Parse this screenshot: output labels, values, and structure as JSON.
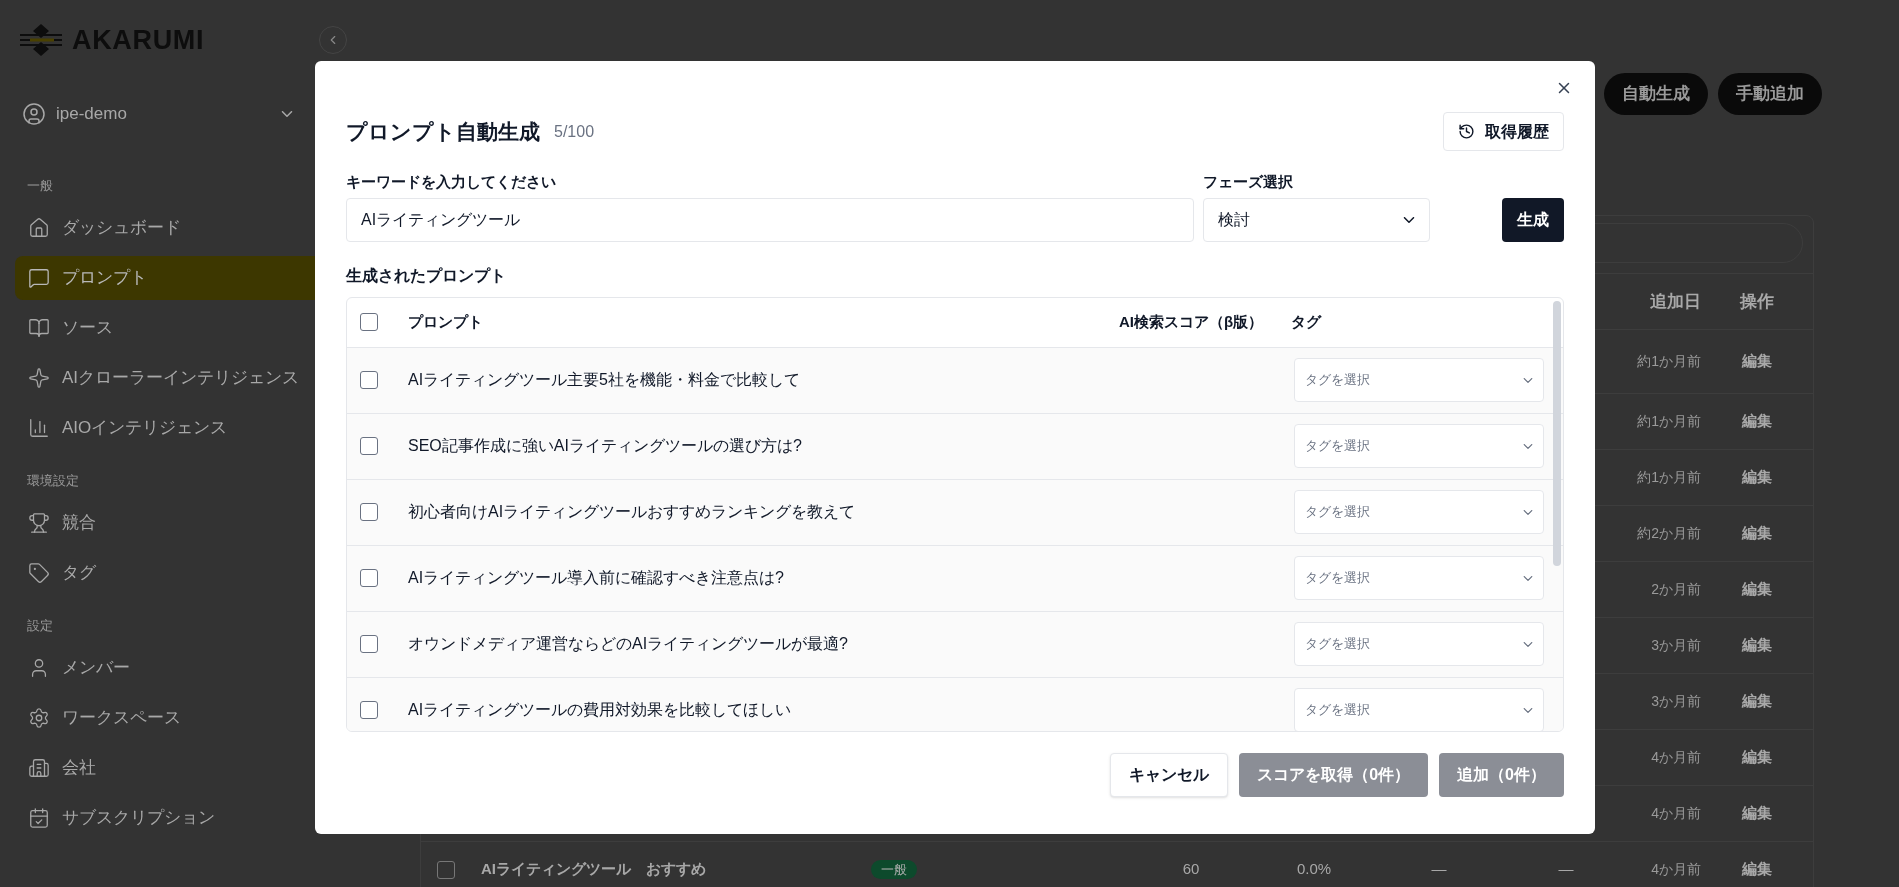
{
  "sidebar": {
    "brand": "AKARUMI",
    "account": "ipe-demo",
    "sections": [
      {
        "heading": "一般",
        "items": [
          {
            "label": "ダッシュボード",
            "selected": false
          },
          {
            "label": "プロンプト",
            "selected": true
          },
          {
            "label": "ソース",
            "selected": false
          },
          {
            "label": "AIクローラーインテリジェンス",
            "selected": false
          },
          {
            "label": "AIOインテリジェンス",
            "selected": false
          }
        ]
      },
      {
        "heading": "環境設定",
        "items": [
          {
            "label": "競合",
            "selected": false
          },
          {
            "label": "タグ",
            "selected": false
          }
        ]
      },
      {
        "heading": "設定",
        "items": [
          {
            "label": "メンバー",
            "selected": false
          },
          {
            "label": "ワークスペース",
            "selected": false
          },
          {
            "label": "会社",
            "selected": false
          },
          {
            "label": "サブスクリプション",
            "selected": false
          }
        ]
      }
    ]
  },
  "page": {
    "actions": [
      "自動生成",
      "手動追加"
    ],
    "table": {
      "columns": [
        "追加日",
        "操作"
      ],
      "rows": [
        {
          "added": "約1か月前",
          "action": "編集"
        },
        {
          "added": "約1か月前",
          "action": "編集"
        },
        {
          "added": "約1か月前",
          "action": "編集"
        },
        {
          "added": "約2か月前",
          "action": "編集"
        },
        {
          "added": "2か月前",
          "action": "編集"
        },
        {
          "added": "3か月前",
          "action": "編集"
        },
        {
          "added": "3か月前",
          "action": "編集"
        },
        {
          "added": "4か月前",
          "action": "編集"
        },
        {
          "added": "4か月前",
          "action": "編集"
        },
        {
          "checked": false,
          "prompt": "AIライティングツール　おすすめ",
          "tag": "一般",
          "column_4": "60",
          "column_5": "0.0%",
          "column_6": "—",
          "column_7": "—",
          "added": "4か月前",
          "action": "編集"
        }
      ]
    }
  },
  "dialog": {
    "title": "プロンプト自動生成",
    "quota": "5/100",
    "history_button": "取得履歴",
    "keyword": {
      "label": "キーワードを入力してください",
      "value": "AIライティングツール"
    },
    "phase": {
      "label": "フェーズ選択",
      "value": "検討"
    },
    "generate_button": "生成",
    "results_label": "生成されたプロンプト",
    "table": {
      "select_all": {
        "checked": false
      },
      "columns": [
        "プロンプト",
        "AI検索スコア（β版）",
        "タグ"
      ],
      "rows": [
        {
          "checked": false,
          "prompt": "AIライティングツール主要5社を機能・料金で比較して",
          "tag_placeholder": "タグを選択"
        },
        {
          "checked": false,
          "prompt": "SEO記事作成に強いAIライティングツールの選び方は?",
          "tag_placeholder": "タグを選択"
        },
        {
          "checked": false,
          "prompt": "初心者向けAIライティングツールおすすめランキングを教えて",
          "tag_placeholder": "タグを選択"
        },
        {
          "checked": false,
          "prompt": "AIライティングツール導入前に確認すべき注意点は?",
          "tag_placeholder": "タグを選択"
        },
        {
          "checked": false,
          "prompt": "オウンドメディア運営ならどのAIライティングツールが最適?",
          "tag_placeholder": "タグを選択"
        },
        {
          "checked": false,
          "prompt": "AIライティングツールの費用対効果を比較してほしい",
          "tag_placeholder": "タグを選択"
        }
      ]
    },
    "buttons": [
      {
        "label": "キャンセル",
        "disabled": false
      },
      {
        "label": "スコアを取得（0件）",
        "disabled": true
      },
      {
        "label": "追加（0件）",
        "disabled": true
      }
    ]
  }
}
